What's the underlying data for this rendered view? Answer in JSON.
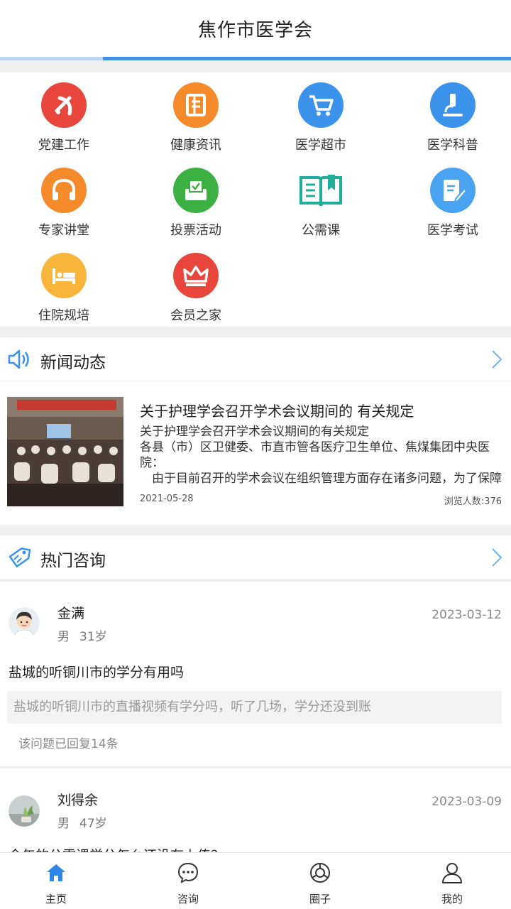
{
  "header": {
    "title": "焦作市医学会"
  },
  "grid": {
    "items": [
      {
        "label": "党建工作",
        "icon": "party-emblem-icon",
        "color": "#e8453c"
      },
      {
        "label": "健康资讯",
        "icon": "document-icon",
        "color": "#f58a2a"
      },
      {
        "label": "医学超市",
        "icon": "shopping-cart-icon",
        "color": "#3a92ea"
      },
      {
        "label": "医学科普",
        "icon": "microscope-icon",
        "color": "#3a92ea"
      },
      {
        "label": "专家讲堂",
        "icon": "headphones-icon",
        "color": "#f58a2a"
      },
      {
        "label": "投票活动",
        "icon": "ballot-box-icon",
        "color": "#3cb043"
      },
      {
        "label": "公需课",
        "icon": "open-book-icon",
        "color": "#1fae9a"
      },
      {
        "label": "医学考试",
        "icon": "edit-paper-icon",
        "color": "#4aa3f0"
      },
      {
        "label": "住院规培",
        "icon": "hospital-bed-icon",
        "color": "#f8b53a"
      },
      {
        "label": "会员之家",
        "icon": "crown-icon",
        "color": "#e8453c"
      }
    ]
  },
  "news": {
    "section_title": "新闻动态",
    "section_icon": "speaker-icon",
    "item": {
      "title": "关于护理学会召开学术会议期间的 有关规定",
      "body_lines": [
        "关于护理学会召开学术会议期间的有关规定",
        "各县（市）区卫健委、市直市管各医疗卫生单位、焦煤集团中央医院：",
        "　由于目前召开的学术会议在组织管理方面存在诸多问题，为了保障今后的护理学术会议顺利召开，特在今后会议中予以规范"
      ],
      "date": "2021-05-28",
      "views": "浏览人数:376"
    }
  },
  "consult": {
    "section_title": "热门咨询",
    "section_icon": "tag-icon",
    "items": [
      {
        "name": "金满",
        "gender": "男",
        "age": "31岁",
        "date": "2023-03-12",
        "question": "盐城的听铜川市的学分有用吗",
        "detail": "盐城的听铜川市的直播视频有学分吗，听了几场，学分还没到账",
        "reply": "该问题已回复14条"
      },
      {
        "name": "刘得余",
        "gender": "男",
        "age": "47岁",
        "date": "2023-03-09",
        "question": "今年的公需课学分怎么还没有上传？"
      }
    ]
  },
  "tabbar": {
    "tabs": [
      {
        "label": "主页",
        "icon": "home-icon",
        "active": true
      },
      {
        "label": "咨询",
        "icon": "chat-icon",
        "active": false
      },
      {
        "label": "圈子",
        "icon": "circle-icon",
        "active": false
      },
      {
        "label": "我的",
        "icon": "user-icon",
        "active": false
      }
    ]
  },
  "colors": {
    "accent": "#3f8fe6",
    "background": "#f0f0f0"
  }
}
